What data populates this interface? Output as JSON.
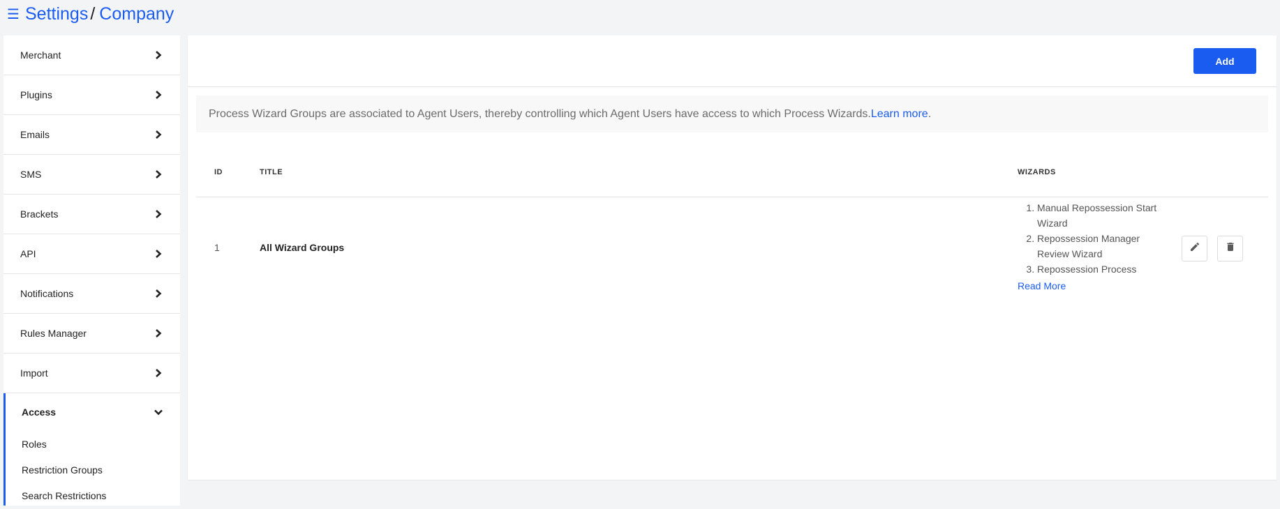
{
  "header": {
    "menu_icon": "hamburger-icon",
    "breadcrumb": [
      "Settings",
      "Company"
    ],
    "separator": "/"
  },
  "sidebar": {
    "items": [
      {
        "label": "Merchant"
      },
      {
        "label": "Plugins"
      },
      {
        "label": "Emails"
      },
      {
        "label": "SMS"
      },
      {
        "label": "Brackets"
      },
      {
        "label": "API"
      },
      {
        "label": "Notifications"
      },
      {
        "label": "Rules Manager"
      },
      {
        "label": "Import"
      }
    ],
    "active_section": {
      "label": "Access",
      "sub_items": [
        "Roles",
        "Restriction Groups",
        "Search Restrictions"
      ]
    }
  },
  "main": {
    "add_label": "Add",
    "info_text": "Process Wizard Groups are associated to Agent Users, thereby controlling which Agent Users have access to which Process Wizards.",
    "info_link": "Learn more",
    "info_suffix": ".",
    "table": {
      "headers": {
        "id": "ID",
        "title": "TITLE",
        "wizards": "WIZARDS"
      },
      "rows": [
        {
          "id": "1",
          "title": "All Wizard Groups",
          "wizards": [
            "Manual Repossession Start Wizard",
            "Repossession Manager Review Wizard",
            "Repossession Process"
          ],
          "read_more": "Read More"
        }
      ]
    }
  },
  "colors": {
    "accent": "#1a5cf0",
    "background": "#f3f4f6",
    "info_bg": "#f8f8f8"
  }
}
